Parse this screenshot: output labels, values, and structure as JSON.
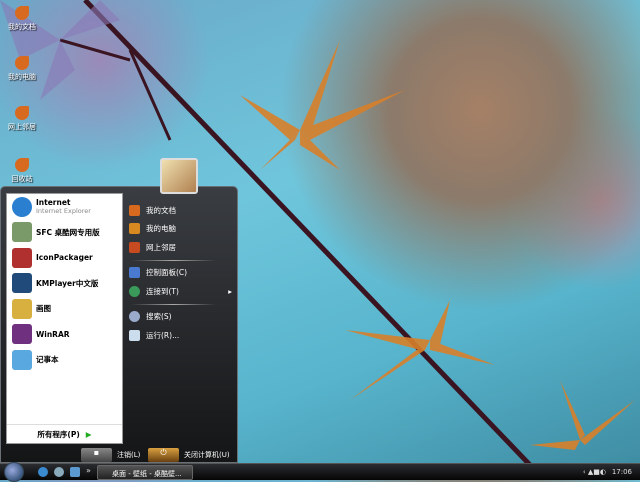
{
  "desktop": {
    "icons": [
      {
        "label": "我的文档"
      },
      {
        "label": "我的电脑"
      },
      {
        "label": "网上邻居"
      },
      {
        "label": "回收站"
      }
    ]
  },
  "start_menu": {
    "pinned": [
      {
        "label": "Internet",
        "sub": "Internet Explorer",
        "color": "#2a7fd0"
      },
      {
        "label": "SFC 桌酷网专用版",
        "color": "#7a9a6a"
      },
      {
        "label": "IconPackager",
        "color": "#b03030"
      },
      {
        "label": "KMPlayer中文版",
        "color": "#204a7a"
      },
      {
        "label": "画图",
        "color": "#d8b040"
      },
      {
        "label": "WinRAR",
        "color": "#703080"
      },
      {
        "label": "记事本",
        "color": "#5aa8e0"
      }
    ],
    "all_programs": "所有程序(P)",
    "right_items": [
      {
        "label": "我的文档"
      },
      {
        "label": "我的电脑"
      },
      {
        "label": "网上邻居"
      },
      {
        "label": "控制面板(C)"
      },
      {
        "label": "连接到(T)"
      },
      {
        "label": "搜索(S)"
      },
      {
        "label": "运行(R)..."
      }
    ],
    "logoff": "注销(L)",
    "shutdown": "关闭计算机(U)"
  },
  "taskbar": {
    "quicklaunch_more": "»",
    "task": "桌面 - 壁纸 - 桌酷壁...",
    "tray_arrow": "‹",
    "clock": "17:06"
  }
}
